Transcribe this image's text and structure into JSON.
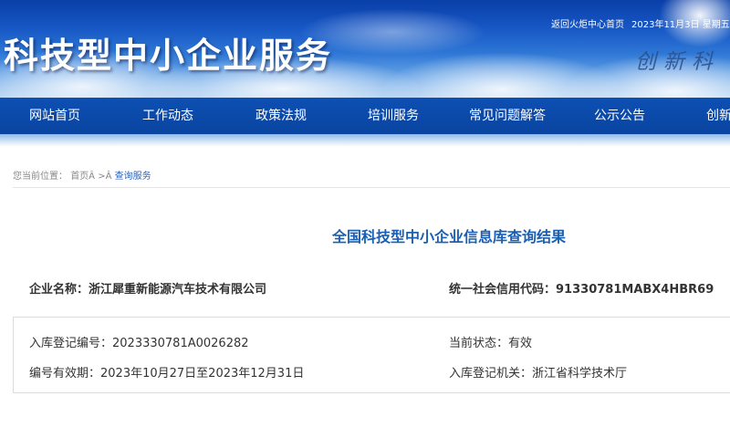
{
  "header": {
    "site_title": "科技型中小企业服务",
    "slogan": "创新科",
    "top_links": {
      "home_link": "返回火炬中心首页",
      "date": "2023年11月3日 星期五"
    }
  },
  "nav": {
    "items": [
      {
        "label": "网站首页"
      },
      {
        "label": "工作动态"
      },
      {
        "label": "政策法规"
      },
      {
        "label": "培训服务"
      },
      {
        "label": "常见问题解答"
      },
      {
        "label": "公示公告"
      },
      {
        "label": "创新"
      }
    ]
  },
  "breadcrumb": {
    "prefix": "您当前位置：",
    "home": "首页Â",
    "sep": ">Â",
    "current": "查询服务"
  },
  "result": {
    "title": "全国科技型中小企业信息库查询结果",
    "company_label": "企业名称：",
    "company_value": "浙江犀重新能源汽车技术有限公司",
    "credit_label": "统一社会信用代码：",
    "credit_value": "91330781MABX4HBR69",
    "reg_no_label": "入库登记编号：",
    "reg_no_value": "2023330781A0026282",
    "status_label": "当前状态：",
    "status_value": "有效",
    "validity_label": "编号有效期：",
    "validity_value": "2023年10月27日至2023年12月31日",
    "authority_label": "入库登记机关：",
    "authority_value": "浙江省科学技术厅"
  },
  "colors": {
    "nav_bg": "#0a45a0",
    "title_blue": "#1a5fb4",
    "link_blue": "#2a62b8"
  }
}
